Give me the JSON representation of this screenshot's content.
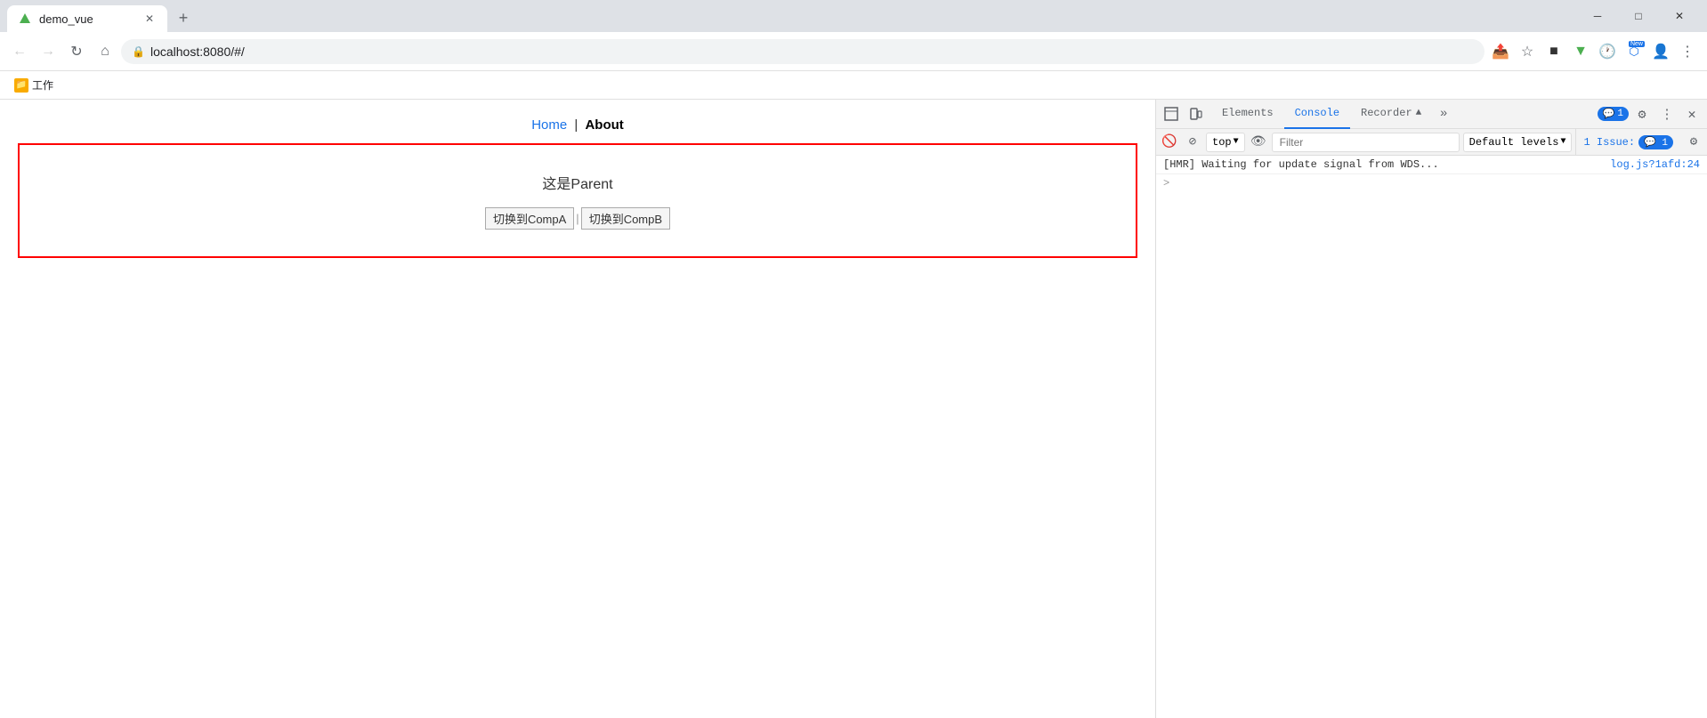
{
  "browser": {
    "tab": {
      "title": "demo_vue",
      "favicon": "▼",
      "favicon_color": "#4caf50"
    },
    "address": "localhost:8080/#/",
    "bookmarks": [
      {
        "label": "工作",
        "icon": "📁"
      }
    ]
  },
  "devtools": {
    "tabs": [
      {
        "label": "Elements",
        "active": false
      },
      {
        "label": "Console",
        "active": true
      },
      {
        "label": "Recorder",
        "active": false
      }
    ],
    "badge_count": "1",
    "console_toolbar": {
      "top_label": "top",
      "filter_placeholder": "Filter",
      "default_levels": "Default levels",
      "issues_label": "1 Issue:",
      "issues_count": "1"
    },
    "console_lines": [
      {
        "msg": "[HMR] Waiting for update signal from WDS...",
        "source": "log.js?1afd:24"
      }
    ],
    "arrow_prompt": ">"
  },
  "webpage": {
    "nav": {
      "home_label": "Home",
      "separator": "|",
      "about_label": "About"
    },
    "parent": {
      "title": "这是Parent",
      "btn_a": "切换到CompA",
      "btn_separator": "|",
      "btn_b": "切换到CompB"
    }
  },
  "window_controls": {
    "minimize": "─",
    "maximize": "□",
    "close": "✕"
  }
}
